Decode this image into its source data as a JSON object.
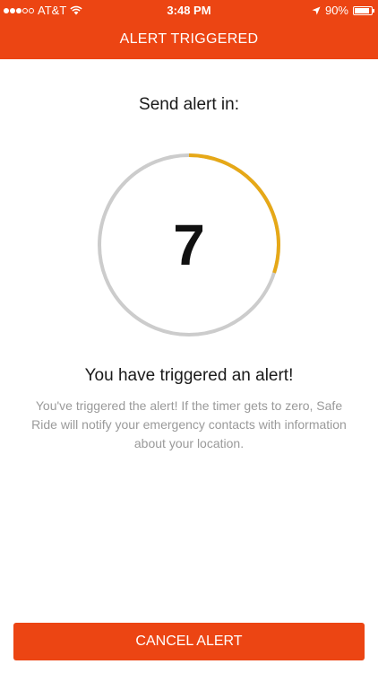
{
  "status_bar": {
    "carrier": "AT&T",
    "time": "3:48 PM",
    "battery_percent": "90%",
    "battery_level": 0.9,
    "signal_bars_filled": 3,
    "signal_bars_total": 5
  },
  "header": {
    "title": "ALERT TRIGGERED"
  },
  "countdown": {
    "label": "Send alert in:",
    "value": "7",
    "progress_fraction": 0.3,
    "progress_color": "#e6a817",
    "track_color": "#cccccc"
  },
  "alert": {
    "title": "You have triggered an alert!",
    "description": "You've triggered the alert!  If the timer gets to zero, Safe Ride will notify your emergency contacts with information about your location."
  },
  "actions": {
    "cancel_label": "CANCEL ALERT"
  },
  "colors": {
    "brand": "#ec4513"
  }
}
